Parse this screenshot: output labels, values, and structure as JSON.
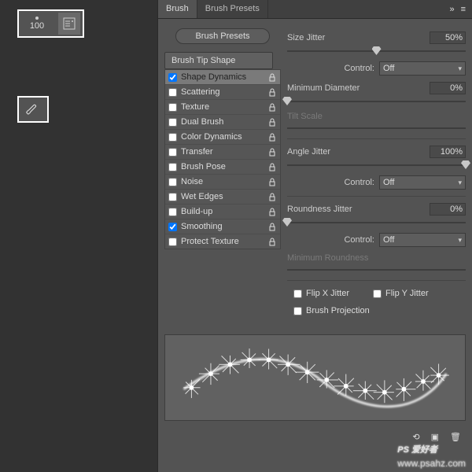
{
  "toolbar": {
    "brush_size": "100"
  },
  "tabs": {
    "brush": "Brush",
    "presets": "Brush Presets"
  },
  "buttons": {
    "presets": "Brush Presets",
    "tipshape": "Brush Tip Shape"
  },
  "opts": [
    {
      "label": "Shape Dynamics",
      "checked": true,
      "selected": true
    },
    {
      "label": "Scattering",
      "checked": false
    },
    {
      "label": "Texture",
      "checked": false
    },
    {
      "label": "Dual Brush",
      "checked": false
    },
    {
      "label": "Color Dynamics",
      "checked": false
    },
    {
      "label": "Transfer",
      "checked": false
    },
    {
      "label": "Brush Pose",
      "checked": false
    },
    {
      "label": "Noise",
      "checked": false
    },
    {
      "label": "Wet Edges",
      "checked": false
    },
    {
      "label": "Build-up",
      "checked": false
    },
    {
      "label": "Smoothing",
      "checked": true
    },
    {
      "label": "Protect Texture",
      "checked": false
    }
  ],
  "controls": {
    "size_jitter": {
      "label": "Size Jitter",
      "value": "50%",
      "pos": 50
    },
    "control_off": "Off",
    "control_label": "Control:",
    "min_diam": {
      "label": "Minimum Diameter",
      "value": "0%",
      "pos": 0
    },
    "tilt": {
      "label": "Tilt Scale"
    },
    "angle_jitter": {
      "label": "Angle Jitter",
      "value": "100%",
      "pos": 100
    },
    "round_jitter": {
      "label": "Roundness Jitter",
      "value": "0%",
      "pos": 0
    },
    "min_round": {
      "label": "Minimum Roundness"
    },
    "flipx": "Flip X Jitter",
    "flipy": "Flip Y Jitter",
    "brushproj": "Brush Projection"
  },
  "watermark": {
    "brand": "PS 爱好者",
    "url": "www.psahz.com"
  }
}
